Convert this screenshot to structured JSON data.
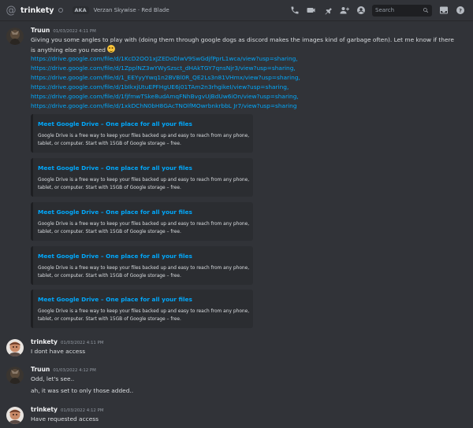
{
  "header": {
    "channel_name": "trinkety",
    "aka_label": "AKA",
    "aka_names": "Verzan Skywise · Red Blade",
    "search_placeholder": "Search",
    "icons": [
      "call-icon",
      "video-call-icon",
      "pinned-messages-icon",
      "add-friends-icon",
      "user-profile-icon",
      "search-icon",
      "inbox-icon",
      "help-icon"
    ]
  },
  "messages": {
    "m1": {
      "author": "Truun",
      "timestamp": "01/03/2022 4:11 PM",
      "line1": "Giving you some angles to play with (doing them through google dogs as discord makes the images kind of garbage often). Let me know if there",
      "line2": "is anything else you need",
      "emoji": "slightly-smiling-face",
      "links": [
        "https://drive.google.com/file/d/1KcD2OO1xJZEDoDlwV9SwGdjfPprL1wca/view?usp=sharing,",
        "https://drive.google.com/file/d/1ZpplNZ3wYWySzsct_dHAkTGY7qnsNjr3/view?usp=sharing,",
        "https://drive.google.com/file/d/1_EEYyyYwq1n2BVBl0R_QE2Ls3n81VHmx/view?usp=sharing,",
        "https://drive.google.com/file/d/1bIkxjUtuEPFHgUE6j01TAm2n3rhgikeI/view?usp=sharing,",
        "https://drive.google.com/file/d/1fjfmwTSke8udAmqFNhBvgvUjBdUw6iOn/view?usp=sharing,",
        "https://drive.google.com/file/d/1xkDChN0bH8GAcTNOlfMOwrbnkrbbL Jr7/view?usp=sharing"
      ],
      "embeds": [
        {
          "title": "Meet Google Drive – One place for all your files",
          "desc": "Google Drive is a free way to keep your files backed up and easy to reach from any phone, tablet, or computer. Start with 15GB of Google storage – free."
        },
        {
          "title": "Meet Google Drive – One place for all your files",
          "desc": "Google Drive is a free way to keep your files backed up and easy to reach from any phone, tablet, or computer. Start with 15GB of Google storage – free."
        },
        {
          "title": "Meet Google Drive – One place for all your files",
          "desc": "Google Drive is a free way to keep your files backed up and easy to reach from any phone, tablet, or computer. Start with 15GB of Google storage – free."
        },
        {
          "title": "Meet Google Drive – One place for all your files",
          "desc": "Google Drive is a free way to keep your files backed up and easy to reach from any phone, tablet, or computer. Start with 15GB of Google storage – free."
        },
        {
          "title": "Meet Google Drive – One place for all your files",
          "desc": "Google Drive is a free way to keep your files backed up and easy to reach from any phone, tablet, or computer. Start with 15GB of Google storage – free."
        }
      ]
    },
    "m2": {
      "author": "trinkety",
      "timestamp": "01/03/2022 4:11 PM",
      "text": "I dont have access"
    },
    "m3": {
      "author": "Truun",
      "timestamp": "01/03/2022 4:12 PM",
      "text": "Odd, let's see..",
      "text2": "ah, it was set to only those added.."
    },
    "m4": {
      "author": "trinkety",
      "timestamp": "01/03/2022 4:12 PM",
      "text": "Have requested access"
    }
  },
  "colors": {
    "background": "#313338",
    "link": "#00a8fc",
    "embed_bg": "#2b2d31"
  }
}
